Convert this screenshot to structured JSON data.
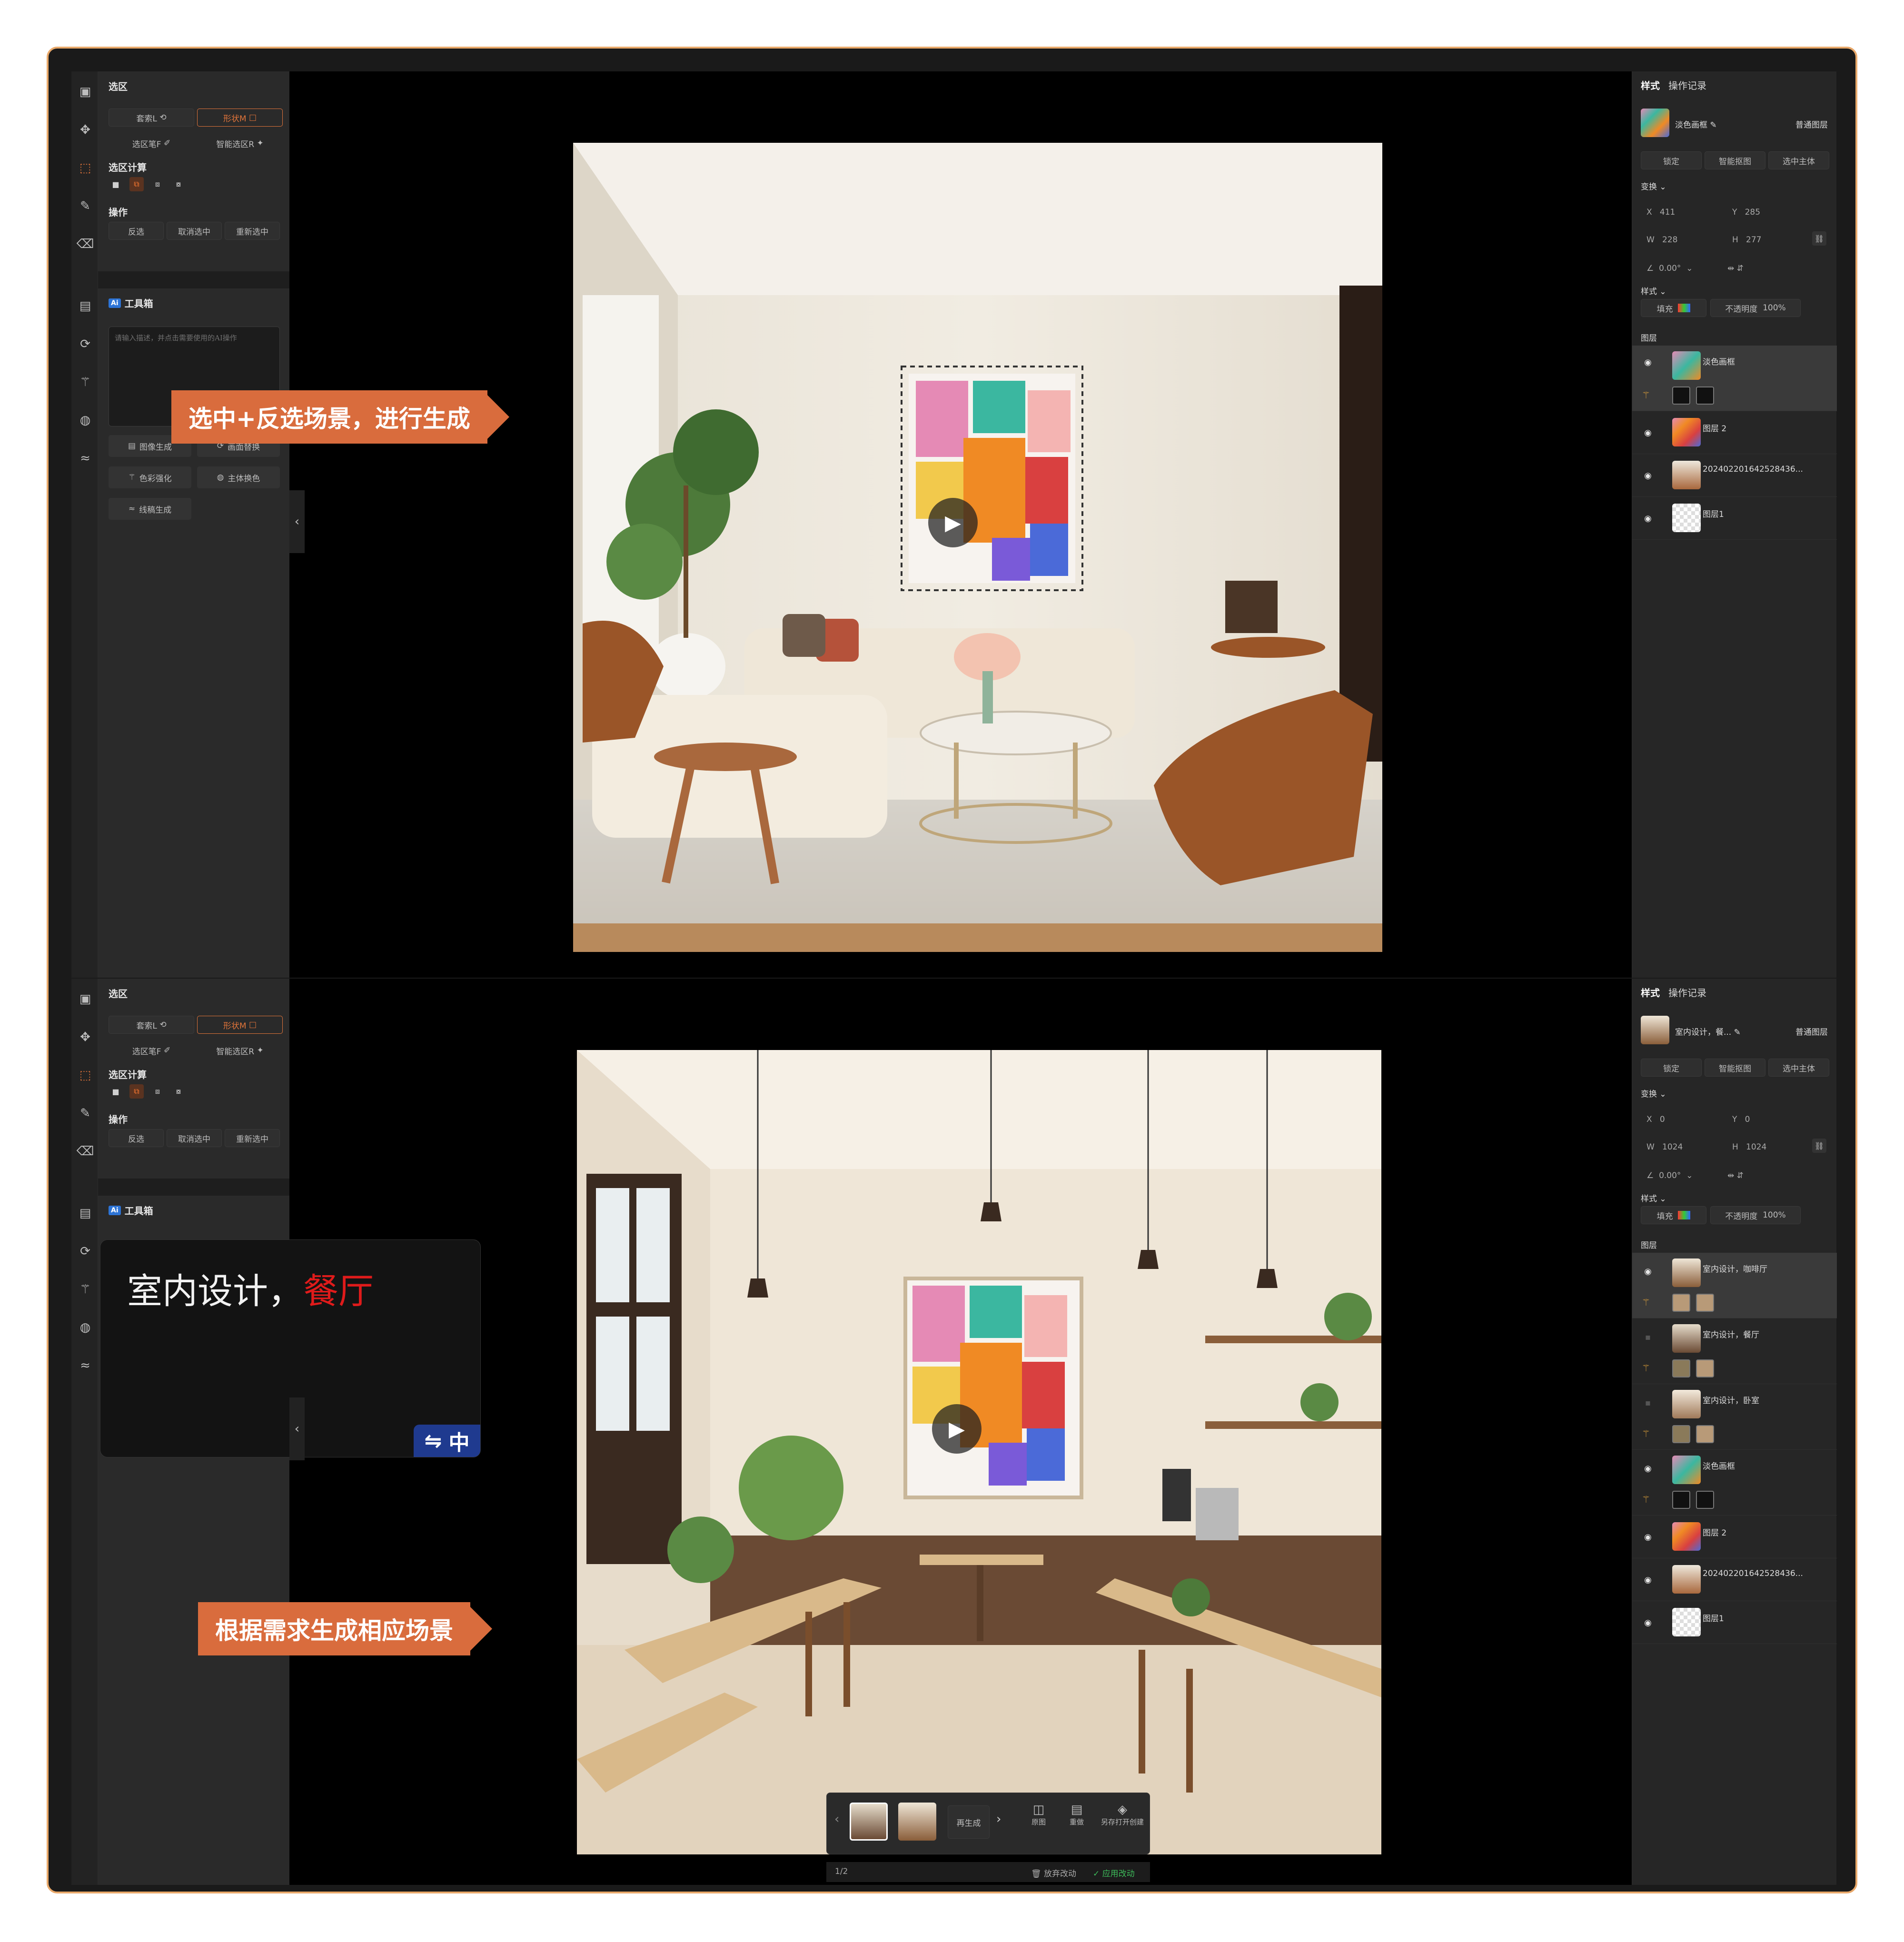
{
  "colors": {
    "accent": "#e0743a",
    "callout": "#d96c3d",
    "prompt_highlight": "#e01b1b",
    "confirm_green": "#3dbb5a"
  },
  "top": {
    "left": {
      "section_title": "选区",
      "mode_a": "套索L",
      "mode_b": "形状M",
      "brush": "选区笔F",
      "smart": "智能选区R",
      "calc_title": "选区计算",
      "ops_title": "操作",
      "invert": "反选",
      "deselect": "取消选中",
      "reselect": "重新选中",
      "ai_badge": "Ai",
      "ai_title": "工具箱",
      "prompt_placeholder": "请输入描述，并点击需要使用的AI操作",
      "tools": [
        "图像生成",
        "画面替换",
        "色彩强化",
        "主体换色",
        "线稿生成"
      ]
    },
    "callout": "选中+反选场景，进行生成",
    "right": {
      "tab_style": "样式",
      "tab_history": "操作记录",
      "object_name": "淡色画框",
      "object_type": "普通图层",
      "btn_lock": "锁定",
      "btn_smart": "智能抠图",
      "btn_subject": "选中主体",
      "transform": "变换",
      "x_label": "X",
      "x": "411",
      "y_label": "Y",
      "y": "285",
      "w_label": "W",
      "w": "228",
      "h_label": "H",
      "h": "277",
      "angle": "0.00°",
      "style_title": "样式",
      "fill": "填充",
      "opacity_label": "不透明度",
      "opacity": "100%",
      "layers_title": "图层",
      "layers": [
        "淡色画框",
        "图层 2",
        "20240220164252843​6...",
        "图层1"
      ]
    }
  },
  "bottom": {
    "left": {
      "section_title": "选区",
      "mode_a": "套索L",
      "mode_b": "形状M",
      "brush": "选区笔F",
      "smart": "智能选区R",
      "calc_title": "选区计算",
      "ops_title": "操作",
      "invert": "反选",
      "deselect": "取消选中",
      "reselect": "重新选中",
      "ai_badge": "Ai",
      "ai_title": "工具箱",
      "prompt_prefix": "室内设计，",
      "prompt_highlight": "餐厅",
      "lang_icon": "⇋",
      "lang": "中"
    },
    "callout": "根据需求生成相应场景",
    "toolbar": {
      "regen": "再生成",
      "compare": "原图",
      "redo": "重做",
      "open_create": "另存打开创建",
      "page": "1/2",
      "discard": "放弃改动",
      "apply": "应用改动"
    },
    "right": {
      "tab_style": "样式",
      "tab_history": "操作记录",
      "object_name": "室内设计，餐...",
      "object_type": "普通图层",
      "btn_lock": "锁定",
      "btn_smart": "智能抠图",
      "btn_subject": "选中主体",
      "transform": "变换",
      "x_label": "X",
      "x": "0",
      "y_label": "Y",
      "y": "0",
      "w_label": "W",
      "w": "1024",
      "h_label": "H",
      "h": "1024",
      "angle": "0.00°",
      "style_title": "样式",
      "fill": "填充",
      "opacity_label": "不透明度",
      "opacity": "100%",
      "layers_title": "图层",
      "layers": [
        "室内设计，咖啡厅",
        "室内设计，餐厅",
        "室内设计，卧室",
        "淡色画框",
        "图层 2",
        "20240220164252843​6...",
        "图层1"
      ]
    }
  }
}
